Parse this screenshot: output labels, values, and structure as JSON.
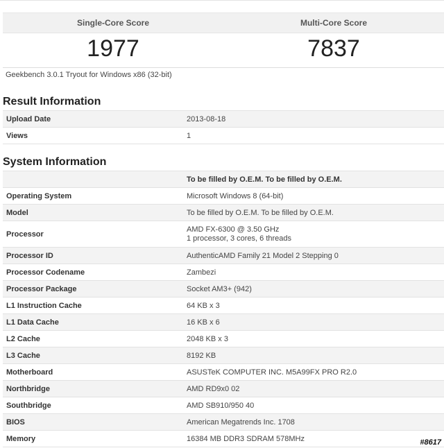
{
  "scores": {
    "single_label": "Single-Core Score",
    "multi_label": "Multi-Core Score",
    "single_value": "1977",
    "multi_value": "7837"
  },
  "version": "Geekbench 3.0.1 Tryout for Windows x86 (32-bit)",
  "result_info": {
    "title": "Result Information",
    "rows": [
      {
        "label": "Upload Date",
        "value": "2013-08-18"
      },
      {
        "label": "Views",
        "value": "1"
      }
    ]
  },
  "system_info": {
    "title": "System Information",
    "header_value": "To be filled by O.E.M. To be filled by O.E.M.",
    "rows": [
      {
        "label": "Operating System",
        "value": "Microsoft Windows 8 (64-bit)"
      },
      {
        "label": "Model",
        "value": "To be filled by O.E.M. To be filled by O.E.M."
      },
      {
        "label": "Processor",
        "value": "AMD FX-6300 @ 3.50 GHz",
        "value2": "1 processor, 3 cores, 6 threads"
      },
      {
        "label": "Processor ID",
        "value": "AuthenticAMD Family 21 Model 2 Stepping 0"
      },
      {
        "label": "Processor Codename",
        "value": "Zambezi"
      },
      {
        "label": "Processor Package",
        "value": "Socket AM3+ (942)"
      },
      {
        "label": "L1 Instruction Cache",
        "value": "64 KB x 3"
      },
      {
        "label": "L1 Data Cache",
        "value": "16 KB x 6"
      },
      {
        "label": "L2 Cache",
        "value": "2048 KB x 3"
      },
      {
        "label": "L3 Cache",
        "value": "8192 KB"
      },
      {
        "label": "Motherboard",
        "value": "ASUSTeK COMPUTER INC. M5A99FX PRO R2.0"
      },
      {
        "label": "Northbridge",
        "value": "AMD RD9x0 02"
      },
      {
        "label": "Southbridge",
        "value": "AMD SB910/950 40"
      },
      {
        "label": "BIOS",
        "value": "American Megatrends Inc. 1708"
      },
      {
        "label": "Memory",
        "value": "16384 MB DDR3 SDRAM 578MHz"
      }
    ]
  },
  "watermark": "#8617"
}
